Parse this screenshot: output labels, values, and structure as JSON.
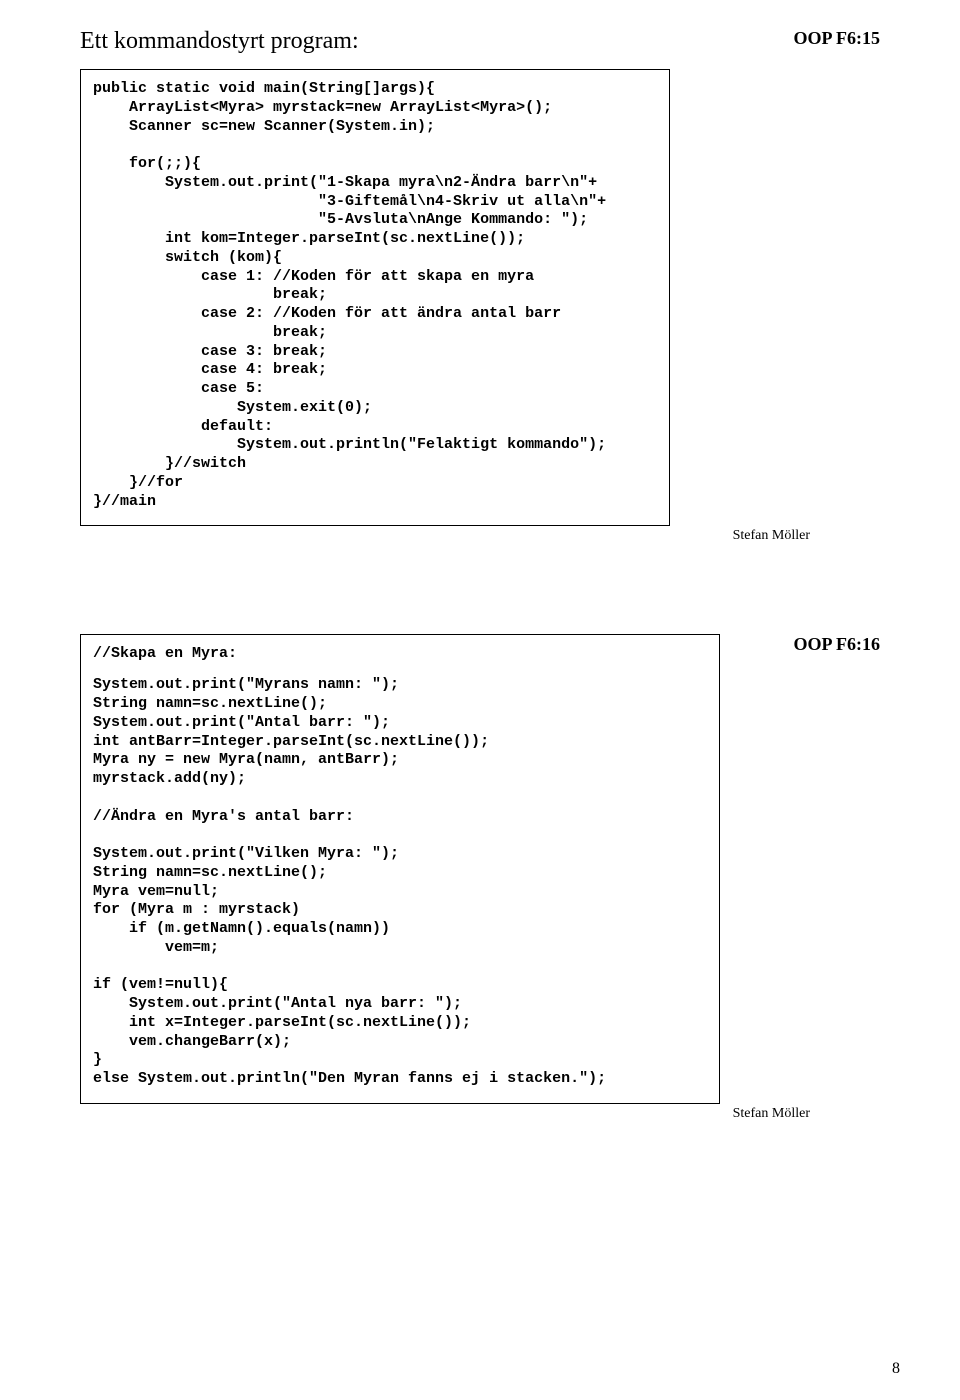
{
  "slide1": {
    "label": "OOP F6:15",
    "title": "Ett kommandostyrt program:",
    "code": "public static void main(String[]args){\n    ArrayList<Myra> myrstack=new ArrayList<Myra>();\n    Scanner sc=new Scanner(System.in);\n\n    for(;;){\n        System.out.print(\"1-Skapa myra\\n2-Ändra barr\\n\"+\n                         \"3-Giftemål\\n4-Skriv ut alla\\n\"+\n                         \"5-Avsluta\\nAnge Kommando: \");\n        int kom=Integer.parseInt(sc.nextLine());\n        switch (kom){\n            case 1: //Koden för att skapa en myra\n                    break;\n            case 2: //Koden för att ändra antal barr\n                    break;\n            case 3: break;\n            case 4: break;\n            case 5:\n                System.exit(0);\n            default:\n                System.out.println(\"Felaktigt kommando\");\n        }//switch\n    }//for\n}//main",
    "author": "Stefan Möller"
  },
  "slide2": {
    "label": "OOP F6:16",
    "comment_head": "//Skapa en Myra:",
    "code": "System.out.print(\"Myrans namn: \");\nString namn=sc.nextLine();\nSystem.out.print(\"Antal barr: \");\nint antBarr=Integer.parseInt(sc.nextLine());\nMyra ny = new Myra(namn, antBarr);\nmyrstack.add(ny);\n\n//Ändra en Myra's antal barr:\n\nSystem.out.print(\"Vilken Myra: \");\nString namn=sc.nextLine();\nMyra vem=null;\nfor (Myra m : myrstack)\n    if (m.getNamn().equals(namn))\n        vem=m;\n\nif (vem!=null){\n    System.out.print(\"Antal nya barr: \");\n    int x=Integer.parseInt(sc.nextLine());\n    vem.changeBarr(x);\n}\nelse System.out.println(\"Den Myran fanns ej i stacken.\");",
    "author": "Stefan Möller"
  },
  "page_number": "8"
}
